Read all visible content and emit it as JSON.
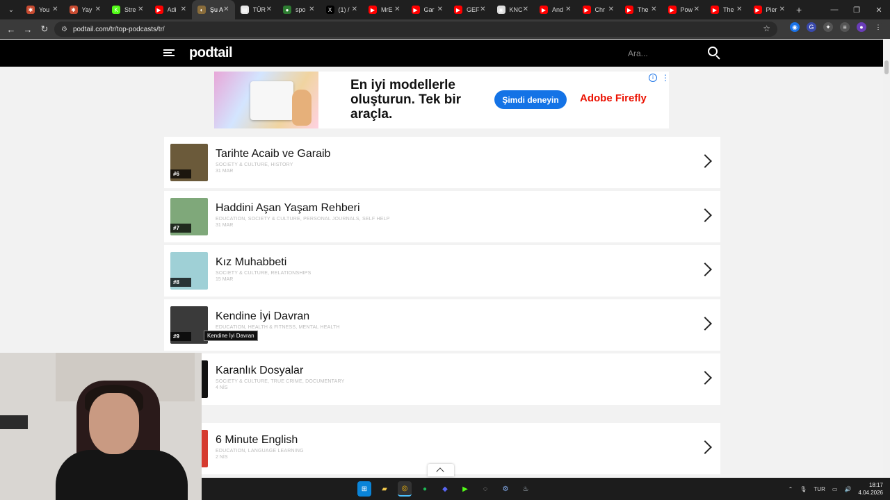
{
  "browser": {
    "tabs": [
      {
        "label": "You",
        "fav_color": "#c84b31",
        "fav_glyph": "✱"
      },
      {
        "label": "Yay",
        "fav_color": "#c84b31",
        "fav_glyph": "✱"
      },
      {
        "label": "Stre",
        "fav_color": "#53fc18",
        "fav_glyph": "K"
      },
      {
        "label": "Adi",
        "fav_color": "#ff0000",
        "fav_glyph": "▶"
      },
      {
        "label": "Şu A",
        "fav_color": "#8a6d3b",
        "fav_glyph": "◐",
        "active": true
      },
      {
        "label": "TÜR",
        "fav_color": "#e6e6e6",
        "fav_glyph": "▤"
      },
      {
        "label": "spo",
        "fav_color": "#2e7d32",
        "fav_glyph": "●"
      },
      {
        "label": "(1) /",
        "fav_color": "#000000",
        "fav_glyph": "X"
      },
      {
        "label": "MrE",
        "fav_color": "#ff0000",
        "fav_glyph": "▶"
      },
      {
        "label": "Gar",
        "fav_color": "#ff0000",
        "fav_glyph": "▶"
      },
      {
        "label": "GEF",
        "fav_color": "#ff0000",
        "fav_glyph": "▶"
      },
      {
        "label": "KNC",
        "fav_color": "#dddddd",
        "fav_glyph": "◉"
      },
      {
        "label": "And",
        "fav_color": "#ff0000",
        "fav_glyph": "▶"
      },
      {
        "label": "Chr",
        "fav_color": "#ff0000",
        "fav_glyph": "▶"
      },
      {
        "label": "The",
        "fav_color": "#ff0000",
        "fav_glyph": "▶"
      },
      {
        "label": "Pow",
        "fav_color": "#ff0000",
        "fav_glyph": "▶"
      },
      {
        "label": "The",
        "fav_color": "#ff0000",
        "fav_glyph": "▶"
      },
      {
        "label": "Pier",
        "fav_color": "#ff0000",
        "fav_glyph": "▶"
      }
    ],
    "new_tab_glyph": "+",
    "url": "podtail.com/tr/top-podcasts/tr/"
  },
  "site": {
    "logo": "podtail",
    "search_placeholder": "Ara..."
  },
  "ad": {
    "headline": "En iyi modellerle oluşturun. Tek bir araçla.",
    "cta": "Şimdi deneyin",
    "brand": "Adobe Firefly",
    "brand_color": "#eb1000",
    "cta_color": "#1473e6"
  },
  "podcasts": [
    {
      "rank": "#6",
      "title": "Tarihte Acaib ve Garaib",
      "categories": "SOCIETY & CULTURE, HISTORY",
      "date": "31 MAR",
      "thumb_color": "#6b5a3a"
    },
    {
      "rank": "#7",
      "title": "Haddini Aşan Yaşam Rehberi",
      "categories": "EDUCATION, SOCIETY & CULTURE, PERSONAL JOURNALS, SELF HELP",
      "date": "31 MAR",
      "thumb_color": "#7fa87a"
    },
    {
      "rank": "#8",
      "title": "Kız Muhabbeti",
      "categories": "SOCIETY & CULTURE, RELATIONSHIPS",
      "date": "15 MAR",
      "thumb_color": "#9fd0d6"
    },
    {
      "rank": "#9",
      "title": "Kendine İyi Davran",
      "categories": "EDUCATION, HEALTH & FITNESS, MENTAL HEALTH",
      "date": "",
      "thumb_color": "#3a3a3a"
    },
    {
      "rank": "",
      "title": "Karanlık Dosyalar",
      "categories": "SOCIETY & CULTURE, TRUE CRIME, DOCUMENTARY",
      "date": "4 NİS",
      "thumb_color": "#111111"
    },
    {
      "rank": "",
      "title": "6 Minute English",
      "categories": "EDUCATION, LANGUAGE LEARNING",
      "date": "2 NİS",
      "thumb_color": "#d63b2f"
    }
  ],
  "tooltip": "Kendine İyi Davran",
  "taskbar": {
    "language": "TUR",
    "time": "18:17",
    "date": "4.04.2026"
  }
}
